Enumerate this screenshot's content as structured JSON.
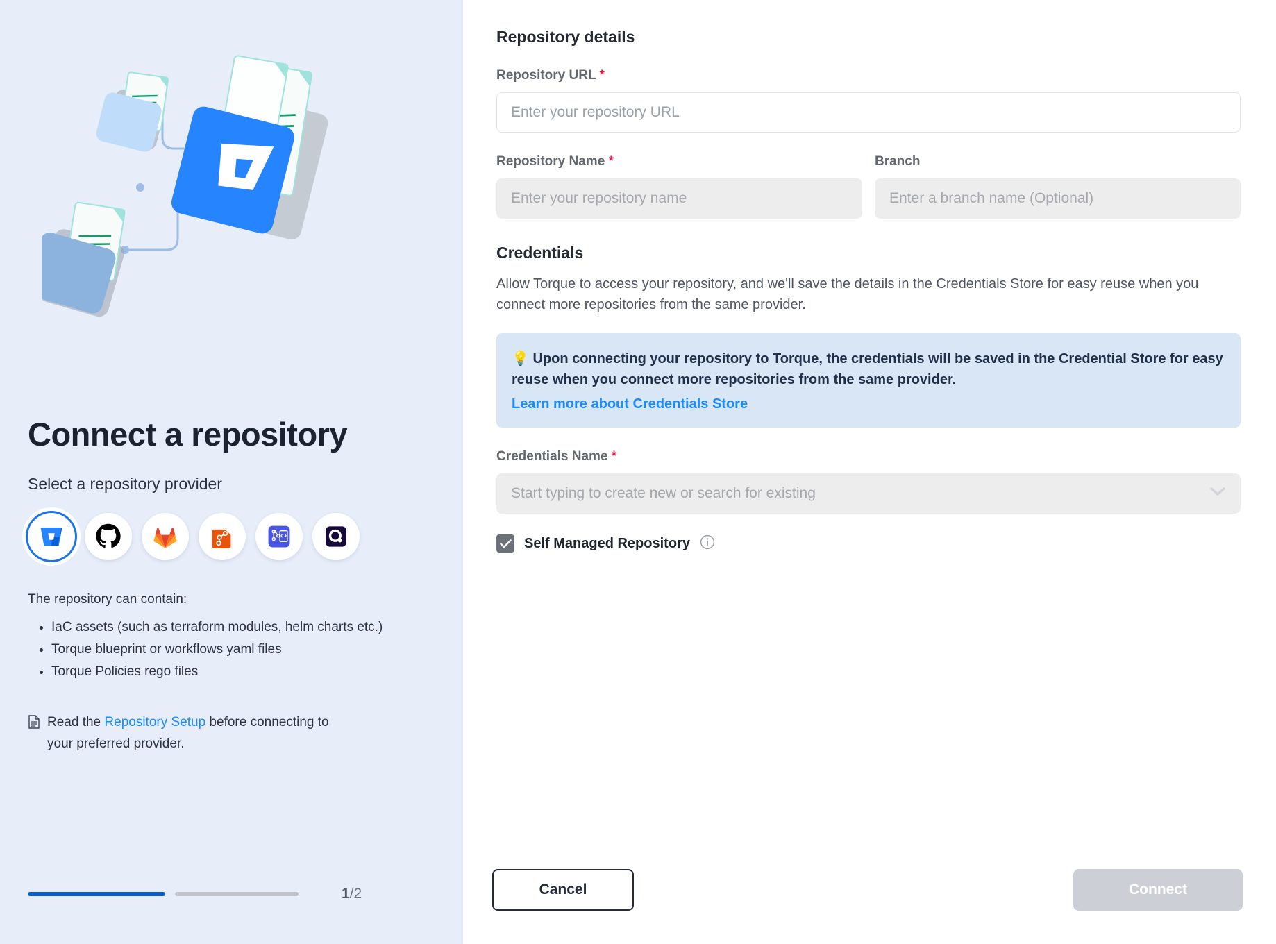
{
  "left": {
    "title": "Connect a repository",
    "subtitle": "Select a repository provider",
    "providers": [
      {
        "name": "bitbucket",
        "label": "Bitbucket",
        "selected": true
      },
      {
        "name": "github",
        "label": "GitHub",
        "selected": false
      },
      {
        "name": "gitlab",
        "label": "GitLab",
        "selected": false
      },
      {
        "name": "codecommit",
        "label": "AWS CodeCommit",
        "selected": false
      },
      {
        "name": "azure-repos",
        "label": "Azure Repos",
        "selected": false
      },
      {
        "name": "quali",
        "label": "Quali",
        "selected": false
      }
    ],
    "contain_label": "The repository can contain:",
    "contain_items": [
      "IaC assets (such as terraform modules, helm charts etc.)",
      "Torque blueprint or workflows yaml files",
      "Torque Policies rego files"
    ],
    "read_note": {
      "icon": "document-icon",
      "before": "Read the ",
      "link": "Repository Setup",
      "after": " before connecting to your preferred provider."
    },
    "progress": {
      "current_step": "1",
      "total_step": "/2",
      "completed_segments": 1,
      "total_segments": 2,
      "done_color": "#0b5cc4",
      "todo_color": "#bfc3c9"
    }
  },
  "form": {
    "section_title": "Repository details",
    "repo_url": {
      "label": "Repository URL",
      "required": "*",
      "placeholder": "Enter your repository URL",
      "value": ""
    },
    "repo_name": {
      "label": "Repository Name",
      "required": "*",
      "placeholder": "Enter your repository name",
      "value": ""
    },
    "branch": {
      "label": "Branch",
      "required": "",
      "placeholder": "Enter a branch name (Optional)",
      "value": ""
    },
    "credentials": {
      "title": "Credentials",
      "description": "Allow Torque to access your repository, and we'll save the details in the Credentials Store for easy reuse when you connect more repositories from the same provider.",
      "info": {
        "icon": "lightbulb-icon",
        "text": "Upon connecting your repository to Torque, the credentials will be saved in the Credential Store for easy reuse when you connect more repositories from the same provider.",
        "link": "Learn more about Credentials Store",
        "bg_color": "#d9e6f5",
        "link_color": "#1a8cff"
      },
      "name_field": {
        "label": "Credentials Name",
        "required": "*",
        "placeholder": "Start typing to create new or search for existing",
        "value": ""
      },
      "self_managed": {
        "label": "Self Managed Repository",
        "checked": true,
        "info_icon": "info-circle-icon"
      }
    }
  },
  "footer": {
    "cancel_label": "Cancel",
    "connect_label": "Connect",
    "connect_disabled": true
  },
  "colors": {
    "panel_bg": "#e7eefa",
    "accent": "#1a73e8",
    "required": "#e01b46",
    "link": "#1a8cff",
    "disabled_btn": "#ccd0d6"
  }
}
